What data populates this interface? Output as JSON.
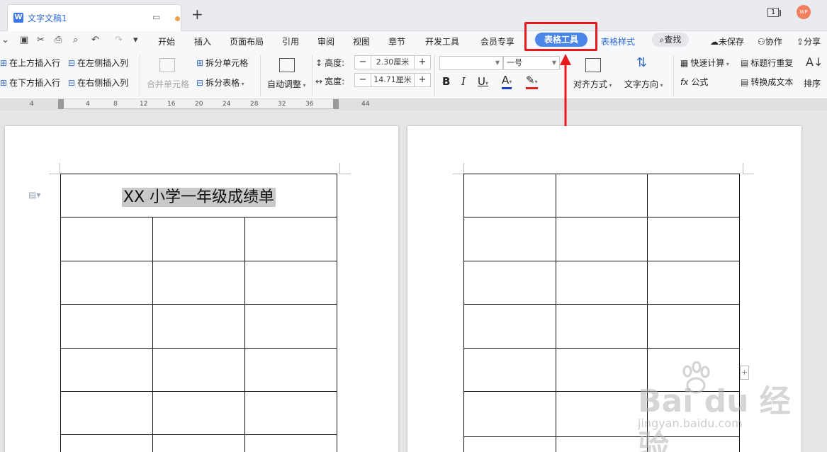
{
  "tabbar": {
    "doc_tab_title": "文字文稿1",
    "app_icon_letter": "W",
    "new_tab": "+",
    "page_count": "1",
    "avatar_text": "WP"
  },
  "menu": {
    "items": [
      "开始",
      "插入",
      "页面布局",
      "引用",
      "审阅",
      "视图",
      "章节",
      "开发工具",
      "会员专享"
    ],
    "active_tab": "表格工具",
    "table_style": "表格样式",
    "search": "查找",
    "unsaved": "未保存",
    "collab": "协作",
    "share": "分享"
  },
  "ribbon": {
    "insert_above": "在上方插入行",
    "insert_below": "在下方插入行",
    "insert_left": "在左侧插入列",
    "insert_right": "在右侧插入列",
    "merge_cells": "合并单元格",
    "split_cells": "拆分单元格",
    "split_table": "拆分表格",
    "auto_fit": "自动调整",
    "height_label": "高度:",
    "height_value": "2.30厘米",
    "width_label": "宽度:",
    "width_value": "14.71厘米",
    "font_size": "一号",
    "align": "对齐方式",
    "text_direction": "文字方向",
    "quick_calc": "快速计算",
    "formula": "公式",
    "repeat_header": "标题行重复",
    "convert_text": "转换成文本",
    "sort": "排序"
  },
  "ruler": {
    "ticks": [
      "4",
      "4",
      "8",
      "12",
      "16",
      "20",
      "24",
      "28",
      "32",
      "36",
      "44"
    ]
  },
  "document": {
    "table_title": "XX 小学一年级成绩单"
  },
  "watermark": {
    "main": "Bai du 经验",
    "sub": "jingyan.baidu.com"
  },
  "colors": {
    "accent_blue": "#4a86e8",
    "highlight_red": "#e8191e"
  }
}
